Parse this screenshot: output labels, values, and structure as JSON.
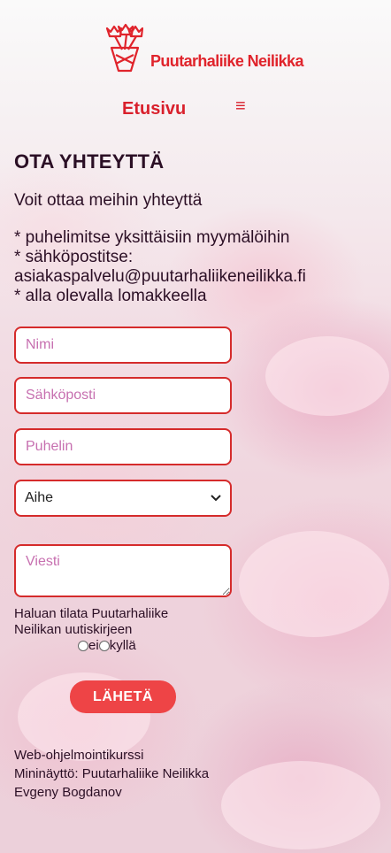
{
  "header": {
    "brand": "Puutarhaliike Neilikka",
    "logo_icon": "flower-bouquet-icon",
    "accent_color": "#e0242c"
  },
  "nav": {
    "home_label": "Etusivu",
    "menu_icon": "≡"
  },
  "main": {
    "title": "OTA YHTEYTTÄ",
    "intro": "Voit ottaa meihin yhteyttä",
    "ways": [
      "* puhelimitse yksittäisiin myymälöihin",
      "* sähköpostitse:",
      "asiakaspalvelu@puutarhaliikeneilikka.fi",
      "* alla olevalla lomakkeella"
    ]
  },
  "form": {
    "name_placeholder": "Nimi",
    "email_placeholder": "Sähköposti",
    "phone_placeholder": "Puhelin",
    "subject_selected": "Aihe",
    "message_placeholder": "Viesti",
    "newsletter_text": "Haluan tilata Puutarhaliike Neilikan uutiskirjeen",
    "radio_no": "ei",
    "radio_yes": "kyllä",
    "submit_label": "LÄHETÄ",
    "submit_color": "#ee4446",
    "border_color": "#d52b2b"
  },
  "footer": {
    "line1": "Web-ohjelmointikurssi",
    "line2": "Mininäyttö: Puutarhaliike Neilikka",
    "line3": "Evgeny Bogdanov"
  }
}
